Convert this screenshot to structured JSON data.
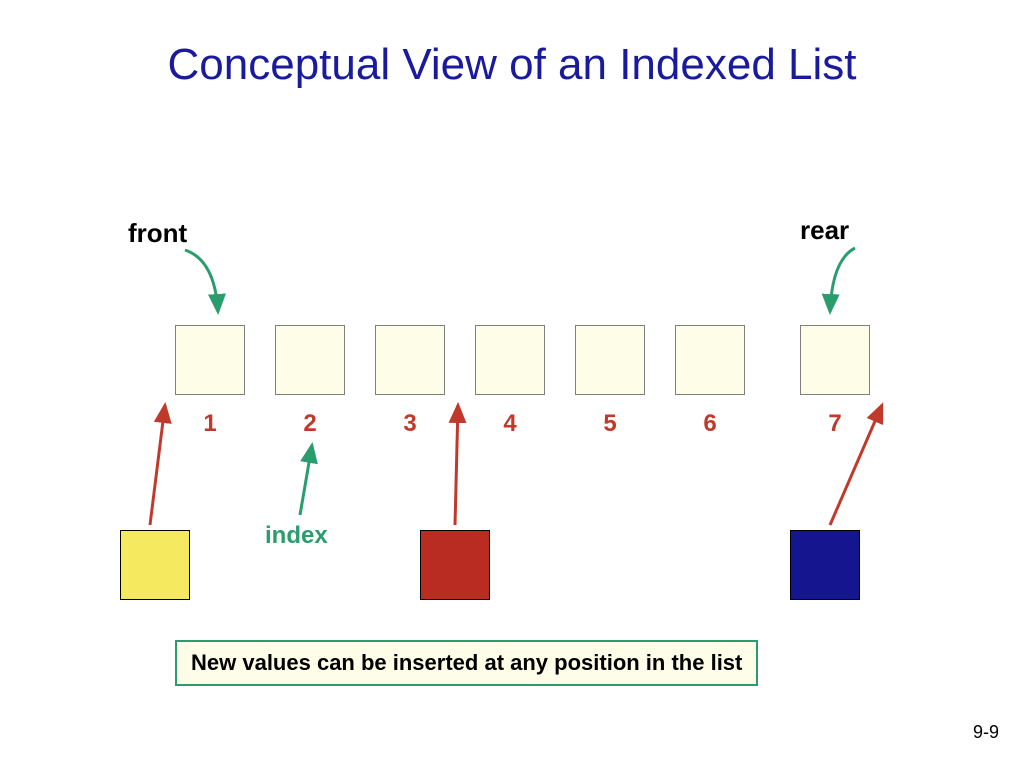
{
  "title": "Conceptual View of an Indexed List",
  "labels": {
    "front": "front",
    "rear": "rear",
    "index": "index"
  },
  "indices": [
    "1",
    "2",
    "3",
    "4",
    "5",
    "6",
    "7"
  ],
  "caption": "New values can be inserted at any position in the list",
  "page_number": "9-9",
  "colors": {
    "title": "#1a1a9e",
    "index_text": "#c0392b",
    "arrow_green": "#2a9d6f",
    "arrow_red": "#c0392b",
    "cell_fill": "#fdfde8",
    "insert_yellow": "#f5e960",
    "insert_red": "#b92c22",
    "insert_blue": "#15158f"
  },
  "chart_data": {
    "type": "table",
    "description": "Diagram of an indexed list with 7 slots (indices 1..7). 'front' label points to slot 1, 'rear' label points to slot 7, 'index' label points to index number 2. Three colored squares below (yellow, red, blue) have arrows indicating insertion into arbitrary gaps between slots.",
    "slots": 7,
    "front_points_to_index": 1,
    "rear_points_to_index": 7,
    "index_label_points_to": 2,
    "insertions": [
      {
        "color": "yellow",
        "arrow_target_gap_before_index": 1
      },
      {
        "color": "red",
        "arrow_target_gap_before_index": 4
      },
      {
        "color": "blue",
        "arrow_target_gap_after_index": 7
      }
    ]
  }
}
